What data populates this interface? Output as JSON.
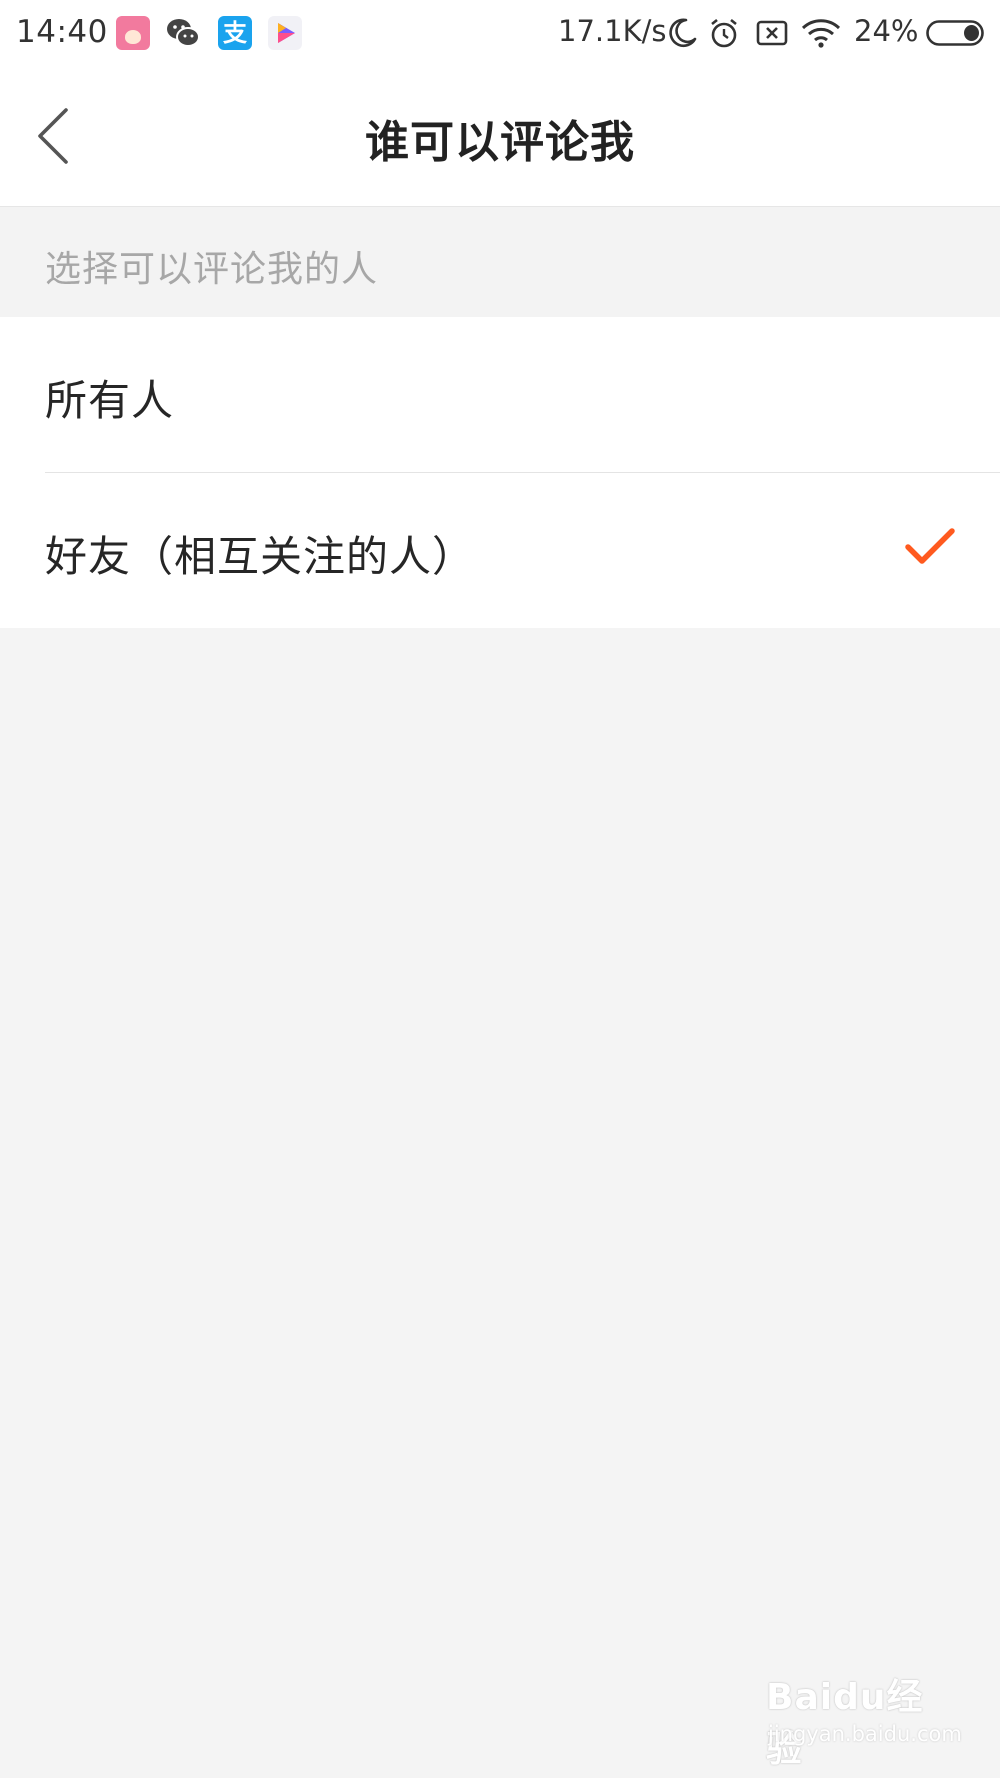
{
  "status_bar": {
    "time": "14:40",
    "network_speed": "17.1K/s",
    "battery_percent": "24%",
    "battery_level": 0.24,
    "icons": [
      "pink-app-icon",
      "wechat-icon",
      "alipay-icon",
      "video-play-icon",
      "moon-icon",
      "alarm-icon",
      "no-sim-icon",
      "wifi-icon",
      "battery-icon"
    ],
    "alipay_glyph": "支"
  },
  "nav": {
    "title": "谁可以评论我",
    "back_icon": "chevron-left-icon"
  },
  "section": {
    "header": "选择可以评论我的人"
  },
  "options": [
    {
      "label": "所有人",
      "selected": false
    },
    {
      "label": "好友（相互关注的人）",
      "selected": true
    }
  ],
  "colors": {
    "accent": "#ff5a1f",
    "background": "#f4f4f4",
    "surface": "#ffffff",
    "section_text": "#a7a7a7"
  },
  "watermark": {
    "logo": "Baidu经验",
    "url": "jingyan.baidu.com"
  }
}
